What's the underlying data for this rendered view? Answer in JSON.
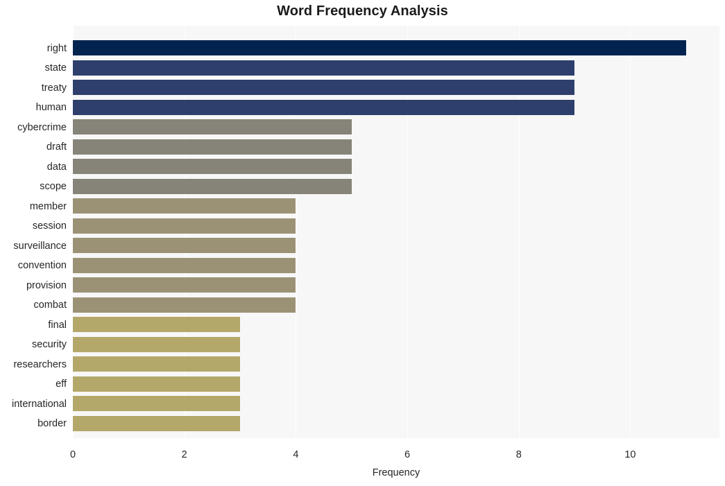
{
  "chart_data": {
    "type": "bar",
    "orientation": "horizontal",
    "title": "Word Frequency Analysis",
    "xlabel": "Frequency",
    "ylabel": "",
    "xlim": [
      0,
      11.6
    ],
    "xticks": [
      0,
      2,
      4,
      6,
      8,
      10
    ],
    "xticklabels": [
      "0",
      "2",
      "4",
      "6",
      "8",
      "10"
    ],
    "grid": "vertical-only",
    "legend": "none",
    "categories": [
      "right",
      "state",
      "treaty",
      "human",
      "cybercrime",
      "draft",
      "data",
      "scope",
      "member",
      "session",
      "surveillance",
      "convention",
      "provision",
      "combat",
      "final",
      "security",
      "researchers",
      "eff",
      "international",
      "border"
    ],
    "values": [
      11,
      9,
      9,
      9,
      5,
      5,
      5,
      5,
      4,
      4,
      4,
      4,
      4,
      4,
      3,
      3,
      3,
      3,
      3,
      3
    ],
    "bar_colors": [
      "#022350",
      "#2e3f6d",
      "#2e3f6d",
      "#2e3f6d",
      "#868478",
      "#868478",
      "#868478",
      "#868478",
      "#9b9275",
      "#9b9275",
      "#9b9275",
      "#9b9275",
      "#9b9275",
      "#9b9275",
      "#b3a869",
      "#b3a869",
      "#b3a869",
      "#b3a869",
      "#b3a869",
      "#b3a869"
    ]
  },
  "style": {
    "figure_background": "#ffffff",
    "plot_background": "#f7f7f7",
    "gridline_color": "#ffffff",
    "text_color": "#262626",
    "title_color": "#1a1a1a"
  }
}
